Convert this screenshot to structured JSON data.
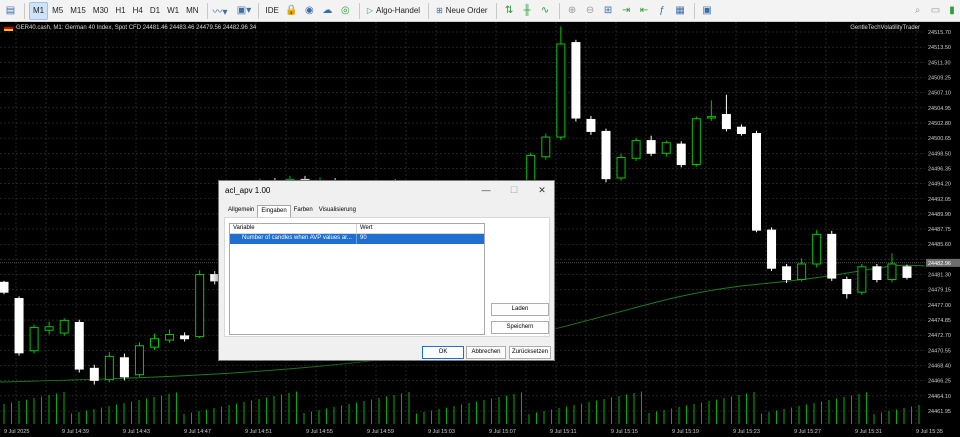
{
  "toolbar": {
    "timeframes": [
      "M1",
      "M5",
      "M15",
      "M30",
      "H1",
      "H4",
      "D1",
      "W1",
      "MN"
    ],
    "active_timeframe": "M1",
    "ide_label": "IDE",
    "algo_label": "Algo-Handel",
    "new_order_label": "Neue Order"
  },
  "chart": {
    "header": "GER40.cash, M1:  German 40 Index, Spot CFD  24481.46 24483.46 24479.56 24482.96  34",
    "ea_label": "GentleTechVolatilityTrader",
    "price_labels": [
      "24515.70",
      "24513.50",
      "24511.30",
      "24509.25",
      "24507.10",
      "24504.95",
      "24502.80",
      "24500.65",
      "24498.50",
      "24496.35",
      "24494.20",
      "24492.05",
      "24489.90",
      "24487.75",
      "24485.60",
      "24482.96",
      "24481.30",
      "24479.15",
      "24477.00",
      "24474.85",
      "24472.70",
      "24470.55",
      "24468.40",
      "24466.25",
      "24464.10",
      "24461.95"
    ],
    "current_price": "24482.96",
    "time_labels": [
      "9 Jul 2025",
      "9 Jul 14:39",
      "9 Jul 14:43",
      "9 Jul 14:47",
      "9 Jul 14:51",
      "9 Jul 14:55",
      "9 Jul 14:59",
      "9 Jul 15:03",
      "9 Jul 15:07",
      "9 Jul 15:11",
      "9 Jul 15:15",
      "9 Jul 15:19",
      "9 Jul 15:23",
      "9 Jul 15:27",
      "9 Jul 15:31",
      "9 Jul 15:35"
    ],
    "bull_color": "#00c800",
    "bear_color": "#ffffff",
    "ma_color": "#1e7a1e",
    "volume_color": "#00b000"
  },
  "dialog": {
    "title": "acl_apv 1.00",
    "tabs": [
      "Allgemein",
      "Eingaben",
      "Farben",
      "Visualisierung"
    ],
    "active_tab": "Eingaben",
    "columns": [
      "Variable",
      "Wert"
    ],
    "rows": [
      {
        "variable": "Number of candles when AVP values ar...",
        "value": "90"
      }
    ],
    "load_label": "Laden",
    "save_label": "Speichern",
    "ok_label": "OK",
    "cancel_label": "Abbrechen",
    "reset_label": "Zurücksetzen"
  }
}
